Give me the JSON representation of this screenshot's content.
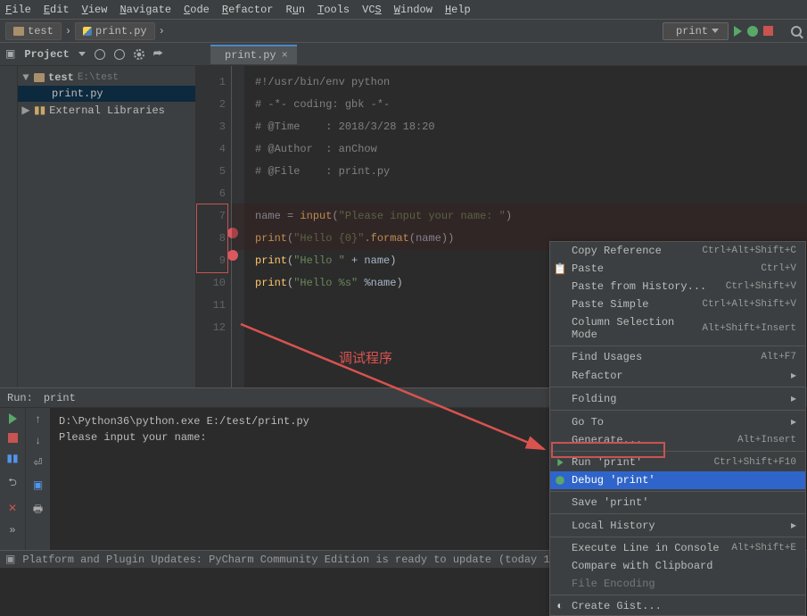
{
  "menu": {
    "items": [
      "File",
      "Edit",
      "View",
      "Navigate",
      "Code",
      "Refactor",
      "Run",
      "Tools",
      "VCS",
      "Window",
      "Help"
    ]
  },
  "breadcrumb": {
    "folder": "test",
    "file": "print.py"
  },
  "runConfig": {
    "selected": "print"
  },
  "toolwindow": {
    "title": "Project"
  },
  "project": {
    "root": "test",
    "rootPath": "E:\\test",
    "file": "print.py",
    "extLib": "External Libraries"
  },
  "tab": {
    "name": "print.py"
  },
  "editor": {
    "lines": [
      "#!/usr/bin/env python",
      "# -*- coding: gbk -*-",
      "# @Time    : 2018/3/28 18:20",
      "# @Author  : anChow",
      "# @File    : print.py",
      "",
      "name = input(\"Please input your name: \")",
      "print(\"Hello {0}\".format(name))",
      "print(\"Hello \" + name)",
      "print(\"Hello %s\" %name)",
      "",
      ""
    ],
    "breakpoints": [
      8,
      9
    ],
    "annotation": "调试程序"
  },
  "run": {
    "label": "Run:",
    "config": "print",
    "out1": "D:\\Python36\\python.exe E:/test/print.py",
    "out2": "Please input your name:"
  },
  "status": {
    "msg": "Platform and Plugin Updates: PyCharm Community Edition is ready to update",
    "time": "(today 17:03)"
  },
  "ctx": {
    "items": [
      {
        "label": "Copy Reference",
        "key": "Ctrl+Alt+Shift+C"
      },
      {
        "label": "Paste",
        "key": "Ctrl+V",
        "icon": "paste"
      },
      {
        "label": "Paste from History...",
        "key": "Ctrl+Shift+V"
      },
      {
        "label": "Paste Simple",
        "key": "Ctrl+Alt+Shift+V"
      },
      {
        "label": "Column Selection Mode",
        "key": "Alt+Shift+Insert"
      },
      {
        "sep": true
      },
      {
        "label": "Find Usages",
        "key": "Alt+F7"
      },
      {
        "label": "Refactor",
        "sub": true
      },
      {
        "sep": true
      },
      {
        "label": "Folding",
        "sub": true
      },
      {
        "sep": true
      },
      {
        "label": "Go To",
        "sub": true
      },
      {
        "label": "Generate...",
        "key": "Alt+Insert"
      },
      {
        "sep": true
      },
      {
        "label": "Run 'print'",
        "key": "Ctrl+Shift+F10",
        "icon": "play"
      },
      {
        "label": "Debug 'print'",
        "icon": "bug",
        "sel": true
      },
      {
        "sep": true
      },
      {
        "label": "Save 'print'",
        "icon": "py"
      },
      {
        "sep": true
      },
      {
        "label": "Local History",
        "sub": true
      },
      {
        "sep": true
      },
      {
        "label": "Execute Line in Console",
        "key": "Alt+Shift+E"
      },
      {
        "label": "Compare with Clipboard"
      },
      {
        "label": "File Encoding",
        "dis": true
      },
      {
        "sep": true
      },
      {
        "label": "Create Gist...",
        "icon": "gh"
      }
    ]
  }
}
